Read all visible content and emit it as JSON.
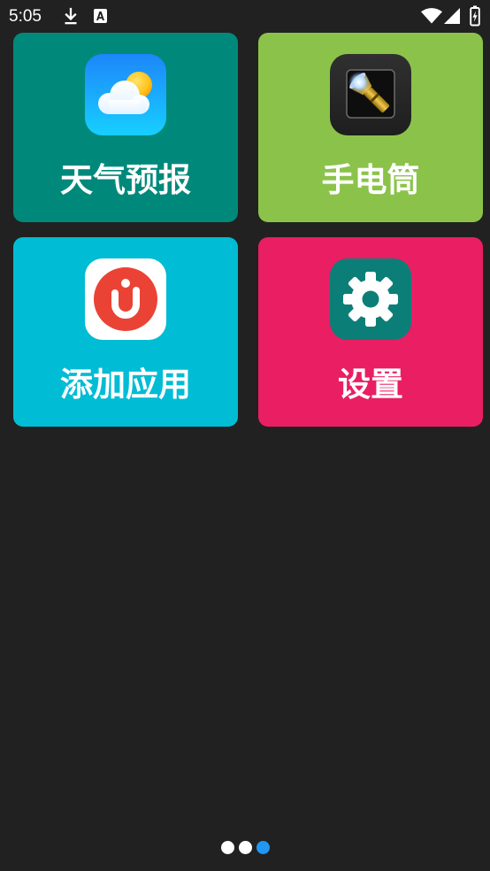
{
  "screen": {
    "background": "#212121"
  },
  "status_bar": {
    "time": "5:05",
    "left_icons": [
      "download-icon",
      "a-notification-icon"
    ],
    "right_icons": [
      "wifi-icon",
      "signal-icon",
      "battery-charging-icon"
    ]
  },
  "tiles": [
    {
      "label": "天气预报",
      "color": "#00897B",
      "icon": "weather-icon"
    },
    {
      "label": "手电筒",
      "color": "#8BC34A",
      "icon": "flashlight-icon"
    },
    {
      "label": "添加应用",
      "color": "#00BCD4",
      "icon": "add-app-icon"
    },
    {
      "label": "设置",
      "color": "#E91E63",
      "icon": "settings-icon"
    }
  ],
  "pager": {
    "page_count": 3,
    "active_index": 2,
    "active_color": "#2196F3",
    "inactive_color": "#FFFFFF"
  }
}
